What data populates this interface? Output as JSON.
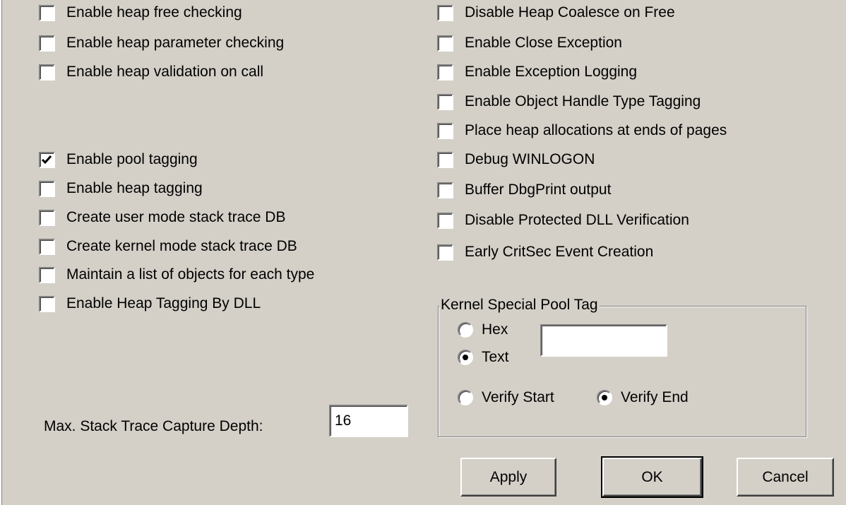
{
  "left_checkboxes": [
    {
      "label": "Enable heap free checking",
      "checked": false
    },
    {
      "label": "Enable heap parameter checking",
      "checked": false
    },
    {
      "label": "Enable heap validation on call",
      "checked": false
    },
    {
      "label": "Enable pool tagging",
      "checked": true
    },
    {
      "label": "Enable heap tagging",
      "checked": false
    },
    {
      "label": "Create user mode stack trace DB",
      "checked": false
    },
    {
      "label": "Create kernel mode stack trace DB",
      "checked": false
    },
    {
      "label": "Maintain a list of objects for each type",
      "checked": false
    },
    {
      "label": "Enable Heap Tagging By DLL",
      "checked": false
    }
  ],
  "right_checkboxes": [
    {
      "label": "Disable Heap Coalesce on Free",
      "checked": false
    },
    {
      "label": "Enable Close Exception",
      "checked": false
    },
    {
      "label": "Enable Exception Logging",
      "checked": false
    },
    {
      "label": "Enable Object Handle Type Tagging",
      "checked": false
    },
    {
      "label": "Place heap allocations at ends of pages",
      "checked": false
    },
    {
      "label": "Debug WINLOGON",
      "checked": false
    },
    {
      "label": "Buffer DbgPrint output",
      "checked": false
    },
    {
      "label": "Disable Protected DLL Verification",
      "checked": false
    },
    {
      "label": "Early CritSec Event Creation",
      "checked": false
    }
  ],
  "stack_depth": {
    "label": "Max. Stack Trace Capture Depth:",
    "value": "16"
  },
  "pool_tag_group": {
    "title": "Kernel Special Pool Tag",
    "hex_label": "Hex",
    "text_label": "Text",
    "selected_format": "Text",
    "tag_value": "",
    "verify_start_label": "Verify Start",
    "verify_end_label": "Verify End",
    "selected_verify": "Verify End"
  },
  "buttons": {
    "apply": "Apply",
    "ok": "OK",
    "cancel": "Cancel"
  }
}
